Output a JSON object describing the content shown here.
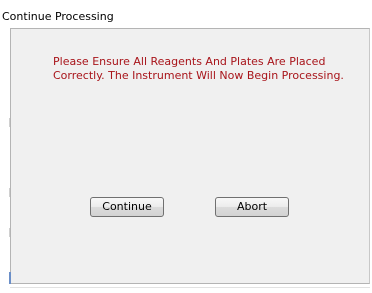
{
  "window": {
    "title": "Continue Processing"
  },
  "dialog": {
    "message_line1": "Please Ensure All Reagents And Plates Are Placed",
    "message_line2": "Correctly. The Instrument Will Now Begin Processing.",
    "message_color": "#a8141a"
  },
  "buttons": {
    "continue_label": "Continue",
    "abort_label": "Abort"
  }
}
